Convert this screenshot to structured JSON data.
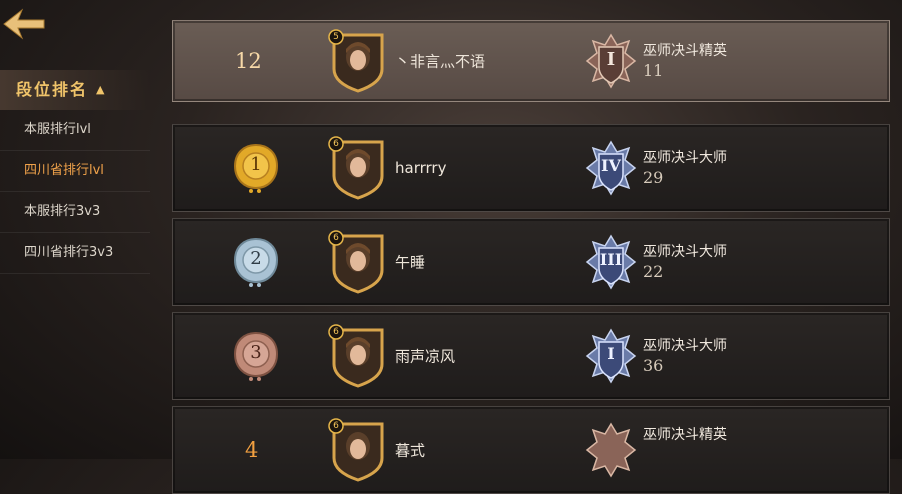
{
  "sidebar": {
    "title": "段位排名",
    "items": [
      {
        "label": "本服排行lvl",
        "active": false
      },
      {
        "label": "四川省排行lvl",
        "active": true
      },
      {
        "label": "本服排行3v3",
        "active": false
      },
      {
        "label": "四川省排行3v3",
        "active": false
      }
    ]
  },
  "self_row": {
    "rank": "12",
    "level": "5",
    "name": "丶非言灬不语",
    "tier": "巫师决斗精英",
    "points": "11",
    "tier_numeral": "I"
  },
  "rows": [
    {
      "rank": "1",
      "level": "6",
      "name": "harrrry",
      "tier": "巫师决斗大师",
      "points": "29",
      "tier_numeral": "IV"
    },
    {
      "rank": "2",
      "level": "6",
      "name": "午睡",
      "tier": "巫师决斗大师",
      "points": "22",
      "tier_numeral": "III"
    },
    {
      "rank": "3",
      "level": "6",
      "name": "雨声凉风",
      "tier": "巫师决斗大师",
      "points": "36",
      "tier_numeral": "I"
    },
    {
      "rank": "4",
      "level": "6",
      "name": "暮式",
      "tier": "巫师决斗精英",
      "points": "",
      "tier_numeral": ""
    }
  ],
  "colors": {
    "gold": "#e2a928",
    "silver": "#a9c2d4",
    "bronze": "#c08a78",
    "accent": "#f0c46a",
    "active": "#f0a24a"
  }
}
